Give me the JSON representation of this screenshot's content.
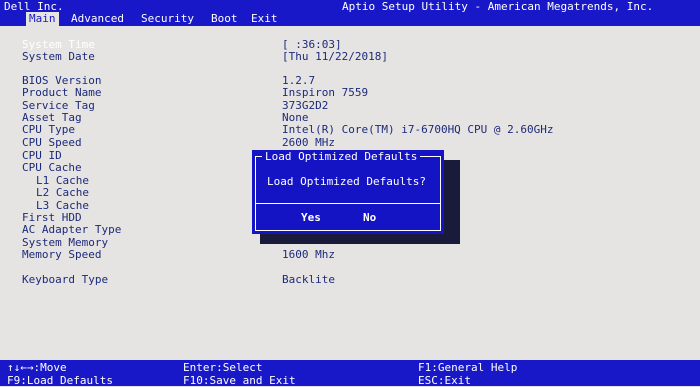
{
  "header": {
    "vendor": "Dell Inc.",
    "title": "Aptio Setup Utility - American Megatrends, Inc.",
    "tabs": [
      "Main",
      "Advanced",
      "Security",
      "Boot",
      "Exit"
    ],
    "active_tab": "Main"
  },
  "main": {
    "system_time": {
      "label": "System Time",
      "value": "[  :36:03]"
    },
    "system_date": {
      "label": "System Date",
      "value": "[Thu 11/22/2018]"
    },
    "bios_version": {
      "label": "BIOS Version",
      "value": "1.2.7"
    },
    "product_name": {
      "label": "Product Name",
      "value": "Inspiron 7559"
    },
    "service_tag": {
      "label": "Service Tag",
      "value": "373G2D2"
    },
    "asset_tag": {
      "label": "Asset Tag",
      "value": "None"
    },
    "cpu_type": {
      "label": "CPU Type",
      "value": "Intel(R) Core(TM) i7-6700HQ CPU @ 2.60GHz"
    },
    "cpu_speed": {
      "label": "CPU Speed",
      "value": "2600 MHz"
    },
    "cpu_id": {
      "label": "CPU ID"
    },
    "cpu_cache": {
      "label": "CPU Cache"
    },
    "l1_cache": {
      "label": "L1 Cache"
    },
    "l2_cache": {
      "label": "L2 Cache"
    },
    "l3_cache": {
      "label": "L3 Cache"
    },
    "first_hdd": {
      "label": "First HDD"
    },
    "ac_adapter_type": {
      "label": "AC Adapter Type"
    },
    "system_memory": {
      "label": "System Memory"
    },
    "memory_speed": {
      "label": "Memory Speed",
      "value": "1600 Mhz"
    },
    "keyboard_type": {
      "label": "Keyboard Type",
      "value": "Backlite"
    }
  },
  "dialog": {
    "title": "Load Optimized Defaults",
    "message": "Load Optimized Defaults?",
    "yes_label": "Yes",
    "no_label": "No"
  },
  "footer": {
    "move": "↑↓←→:Move",
    "load_defaults": "F9:Load Defaults",
    "select": "Enter:Select",
    "save_exit": "F10:Save and Exit",
    "help": "F1:General Help",
    "exit": "ESC:Exit"
  },
  "colors": {
    "bar_blue": "#1818c8",
    "dialog_blue": "#1414c4",
    "background": "#e6e4e2",
    "text": "#1c2a7a"
  }
}
